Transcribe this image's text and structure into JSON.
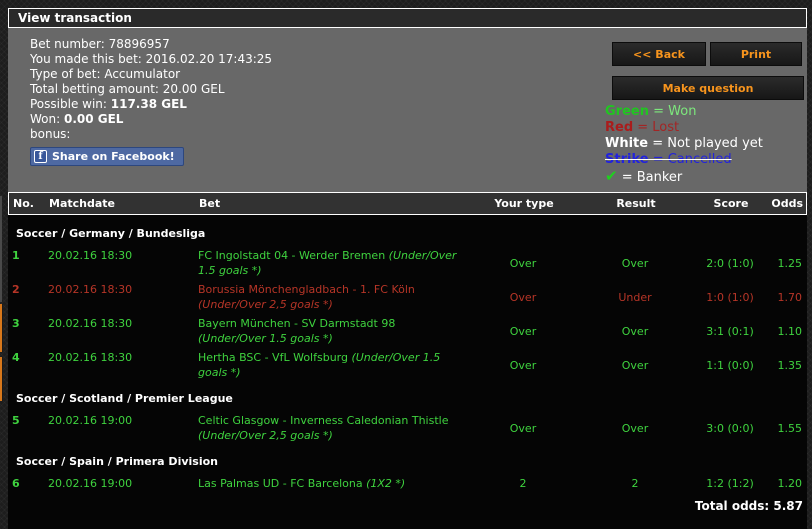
{
  "window": {
    "title": "View transaction"
  },
  "info": {
    "lines": [
      {
        "label": "Bet number:",
        "value": "78896957",
        "bold_value": false
      },
      {
        "label": "You made this bet:",
        "value": "2016.02.20 17:43:25",
        "bold_value": false
      },
      {
        "label": "Type of bet:",
        "value": "Accumulator",
        "bold_value": false
      },
      {
        "label": "Total betting amount:",
        "value": "20.00 GEL",
        "bold_value": false
      },
      {
        "label": "Possible win:",
        "value": "117.38 GEL",
        "bold_value": true
      },
      {
        "label": "Won:",
        "value": "0.00 GEL",
        "bold_value": true
      },
      {
        "label": "bonus:",
        "value": "",
        "bold_value": false
      }
    ],
    "facebook": {
      "icon_letter": "f",
      "label": "Share on Facebook!"
    }
  },
  "actions": {
    "back": "<< Back",
    "print": "Print",
    "make_question": "Make question"
  },
  "legend": {
    "items": [
      {
        "term": "Green",
        "rest": "= Won",
        "kind": "won"
      },
      {
        "term": "Red",
        "rest": "= Lost",
        "kind": "lost"
      },
      {
        "term": "White",
        "rest": "= Not played yet",
        "kind": "notplayed"
      },
      {
        "term": "Strike",
        "rest": "= Cancelled",
        "kind": "cancelled"
      },
      {
        "term": "✔",
        "rest": "= Banker",
        "kind": "banker"
      }
    ]
  },
  "table": {
    "columns": [
      "No.",
      "Matchdate",
      "Bet",
      "Your type",
      "Result",
      "Score",
      "Odds"
    ],
    "sections": [
      {
        "title": "Soccer / Germany / Bundesliga",
        "rows": [
          {
            "no": "1",
            "date": "20.02.16 18:30",
            "match": "FC Ingolstadt 04 - Werder Bremen",
            "market": "(Under/Over 1.5 goals *)",
            "type": "Over",
            "result": "Over",
            "score": "2:0 (1:0)",
            "odds": "1.25",
            "status": "won"
          },
          {
            "no": "2",
            "date": "20.02.16 18:30",
            "match": "Borussia Mönchengladbach - 1. FC Köln",
            "market": "(Under/Over 2,5 goals *)",
            "type": "Over",
            "result": "Under",
            "score": "1:0 (1:0)",
            "odds": "1.70",
            "status": "lost"
          },
          {
            "no": "3",
            "date": "20.02.16 18:30",
            "match": "Bayern München - SV Darmstadt 98",
            "market": "(Under/Over 1.5 goals *)",
            "type": "Over",
            "result": "Over",
            "score": "3:1 (0:1)",
            "odds": "1.10",
            "status": "won"
          },
          {
            "no": "4",
            "date": "20.02.16 18:30",
            "match": "Hertha BSC - VfL Wolfsburg",
            "market": "(Under/Over 1.5 goals *)",
            "type": "Over",
            "result": "Over",
            "score": "1:1 (0:0)",
            "odds": "1.35",
            "status": "won"
          }
        ]
      },
      {
        "title": "Soccer / Scotland / Premier League",
        "rows": [
          {
            "no": "5",
            "date": "20.02.16 19:00",
            "match": "Celtic Glasgow - Inverness Caledonian Thistle",
            "market": "(Under/Over 2,5 goals *)",
            "type": "Over",
            "result": "Over",
            "score": "3:0 (0:0)",
            "odds": "1.55",
            "status": "won"
          }
        ]
      },
      {
        "title": "Soccer / Spain / Primera Division",
        "rows": [
          {
            "no": "6",
            "date": "20.02.16 19:00",
            "match": "Las Palmas UD - FC Barcelona",
            "market": "(1X2 *)",
            "type": "2",
            "result": "2",
            "score": "1:2 (1:2)",
            "odds": "1.20",
            "status": "won"
          }
        ]
      }
    ],
    "total_label": "Total odds:",
    "total_value": "5.87"
  },
  "colors": {
    "accent_orange": "#f7941d",
    "won_green": "#3fd33f",
    "lost_red": "#b63527",
    "cancelled_blue": "#2222dd",
    "facebook_blue": "#4e69a2",
    "panel_grey": "#686868"
  }
}
